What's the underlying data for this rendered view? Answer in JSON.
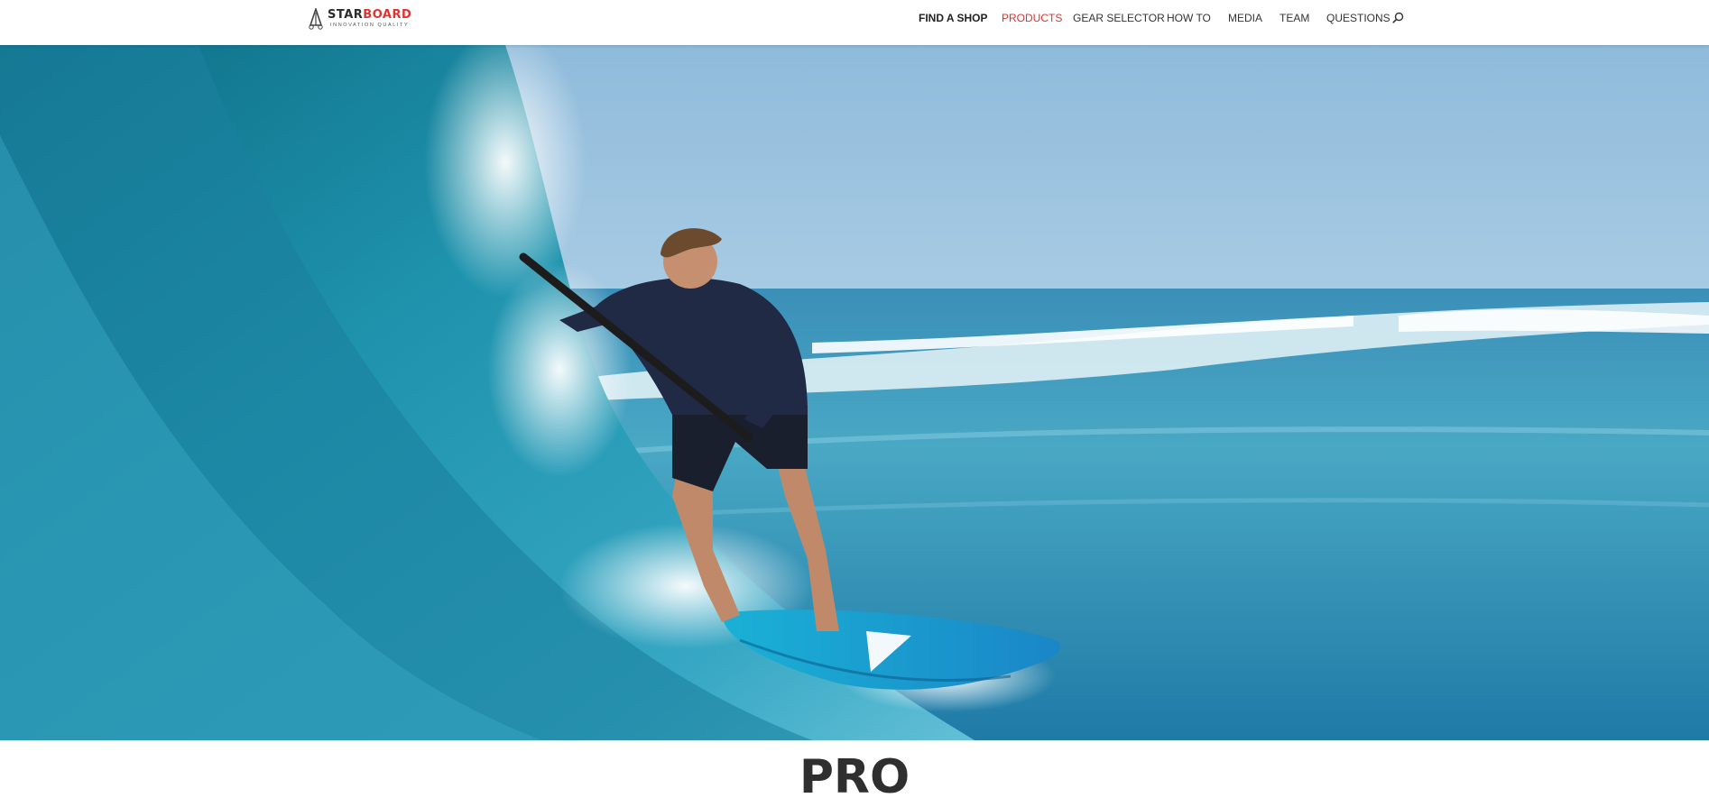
{
  "brand": {
    "name_part1": "STAR",
    "name_part2": "BOARD",
    "tagline": "INNOVATION QUALITY"
  },
  "nav": {
    "items": [
      {
        "label": "FIND A SHOP"
      },
      {
        "label": "PRODUCTS"
      },
      {
        "label": "GEAR SELECTOR"
      },
      {
        "label": "HOW TO"
      },
      {
        "label": "MEDIA"
      },
      {
        "label": "TEAM"
      },
      {
        "label": "QUESTIONS"
      }
    ],
    "active_color": "#d9352f",
    "search_icon": "search-icon"
  },
  "hero": {
    "icon": "surfer-photo"
  },
  "page": {
    "title": "PRO"
  },
  "colors": {
    "brand_red": "#e0322f",
    "text_dark": "#2f2f2f"
  }
}
